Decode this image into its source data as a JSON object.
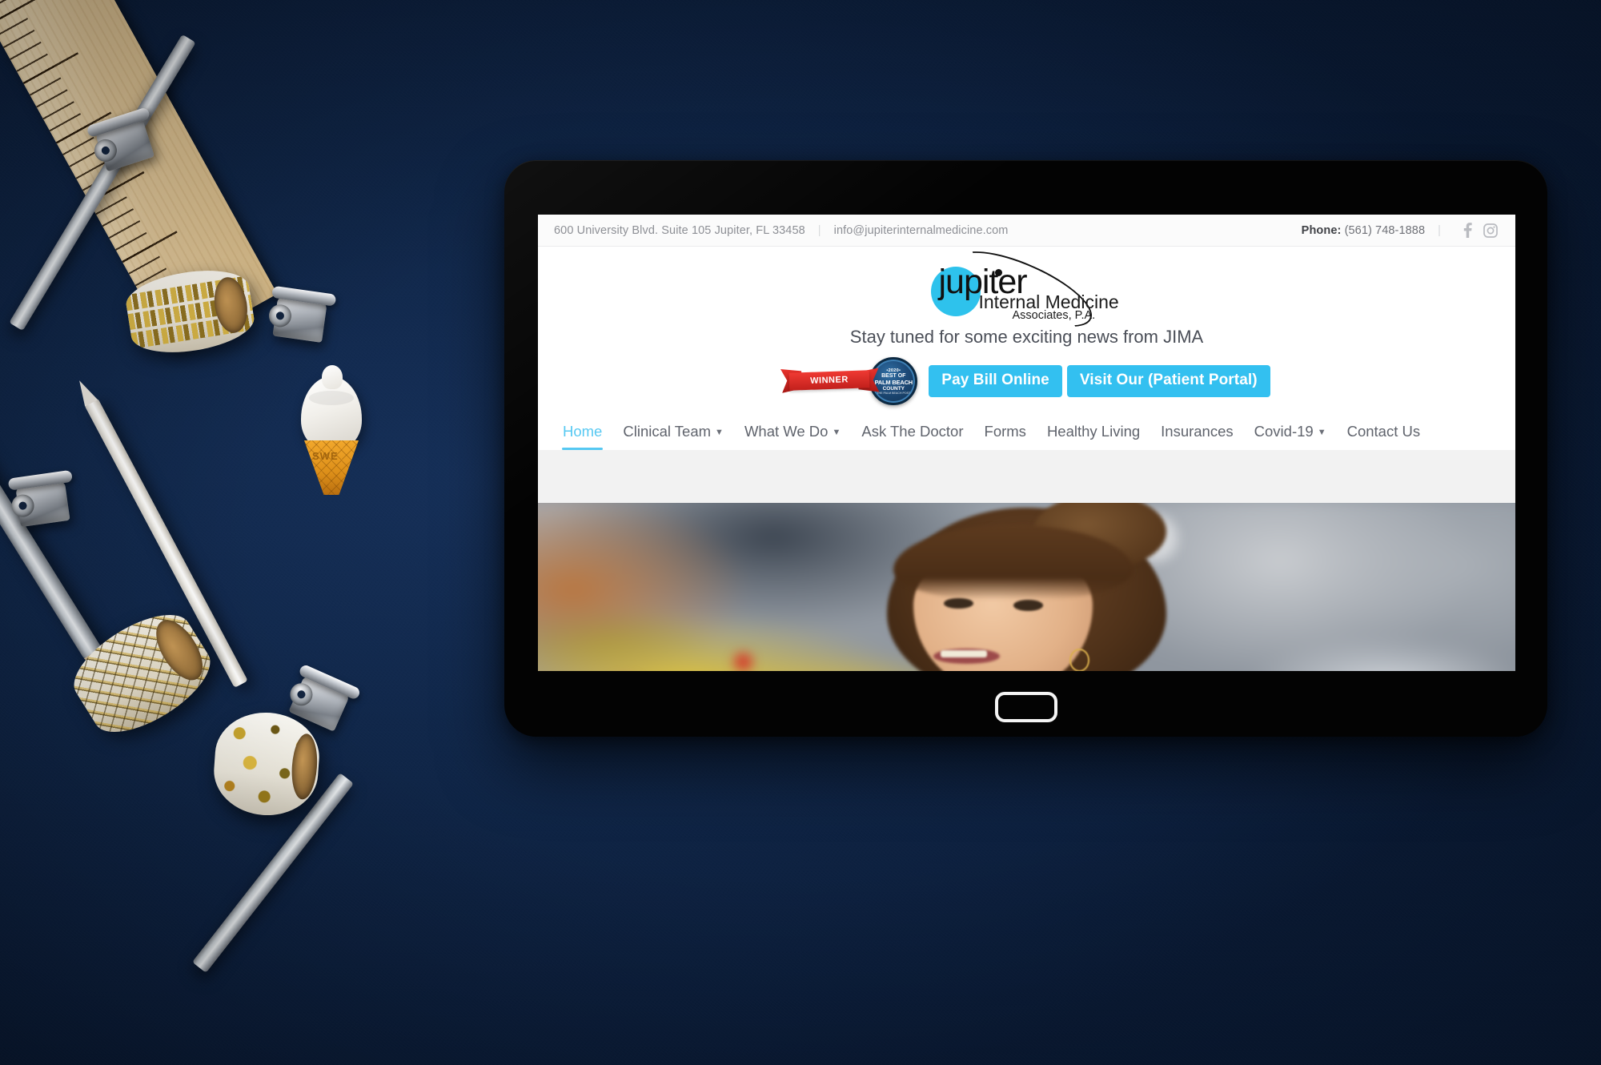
{
  "scene": {
    "description": "Tablet on a navy desk with stationery props",
    "background_color": "#0d2244",
    "props": [
      "wooden-ruler",
      "silver-pencil",
      "white-pencil",
      "binder-clip",
      "washi-tape-triangles",
      "washi-tape-lattice",
      "washi-tape-dots",
      "ice-cream-cone-eraser"
    ],
    "cone_label": "SWE"
  },
  "site": {
    "topbar": {
      "address": "600 University Blvd. Suite 105 Jupiter, FL 33458",
      "separator": "|",
      "email": "info@jupiterinternalmedicine.com",
      "phone_label": "Phone:",
      "phone_number": "(561) 748-1888",
      "phone_separator": "|",
      "social": [
        {
          "name": "facebook-icon",
          "glyph": "f"
        },
        {
          "name": "instagram-icon",
          "glyph": "◻"
        }
      ]
    },
    "logo": {
      "brand_mark": "jupiter",
      "line1": "Internal Medicine",
      "line2": "Associates, P.A.",
      "circle_color": "#2ec2ec"
    },
    "tagline": "Stay tuned for some exciting news from JIMA",
    "badges": {
      "ribbon_text": "WINNER",
      "ribbon_color": "#e8322c",
      "seal": {
        "year": "•2020•",
        "line1": "BEST OF",
        "line2": "PALM BEACH",
        "line3": "COUNTY",
        "line4": "THE PALM BEACH POST",
        "color": "#10304f"
      }
    },
    "cta_buttons": [
      {
        "label": "Pay Bill Online",
        "color": "#33c0f0"
      },
      {
        "label": "Visit Our (Patient Portal)",
        "color": "#33c0f0"
      }
    ],
    "nav": {
      "accent_color": "#56c8f2",
      "items": [
        {
          "label": "Home",
          "active": true,
          "has_dropdown": false
        },
        {
          "label": "Clinical Team",
          "active": false,
          "has_dropdown": true
        },
        {
          "label": "What We Do",
          "active": false,
          "has_dropdown": true
        },
        {
          "label": "Ask The Doctor",
          "active": false,
          "has_dropdown": false
        },
        {
          "label": "Forms",
          "active": false,
          "has_dropdown": false
        },
        {
          "label": "Healthy Living",
          "active": false,
          "has_dropdown": false
        },
        {
          "label": "Insurances",
          "active": false,
          "has_dropdown": false
        },
        {
          "label": "Covid-19",
          "active": false,
          "has_dropdown": true
        },
        {
          "label": "Contact Us",
          "active": false,
          "has_dropdown": false
        }
      ]
    },
    "hero": {
      "alt": "Medical office staff member speaking at reception desk",
      "slider_dot_count": 6,
      "active_dot_index": 0
    }
  }
}
